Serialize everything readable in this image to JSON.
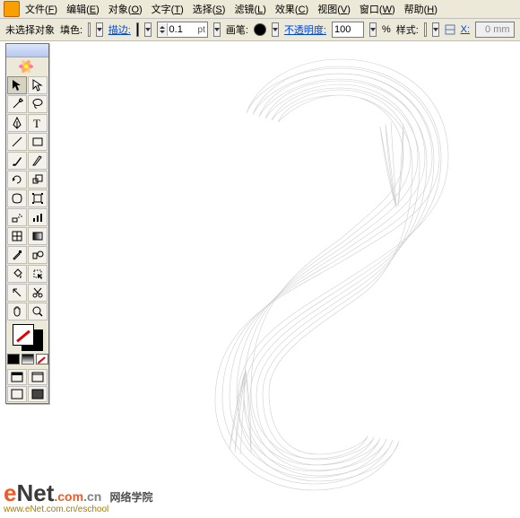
{
  "menu": {
    "items": [
      {
        "label": "文件",
        "accel": "F"
      },
      {
        "label": "编辑",
        "accel": "E"
      },
      {
        "label": "对象",
        "accel": "O"
      },
      {
        "label": "文字",
        "accel": "T"
      },
      {
        "label": "选择",
        "accel": "S"
      },
      {
        "label": "滤镜",
        "accel": "L"
      },
      {
        "label": "效果",
        "accel": "C"
      },
      {
        "label": "视图",
        "accel": "V"
      },
      {
        "label": "窗口",
        "accel": "W"
      },
      {
        "label": "帮助",
        "accel": "H"
      }
    ]
  },
  "optbar": {
    "selection_state": "未选择对象",
    "fill_label": "填色:",
    "stroke_label": "描边:",
    "stroke_weight": {
      "value": "0.1",
      "unit": "pt"
    },
    "brush_label": "画笔:",
    "opacity_label": "不透明度:",
    "opacity_value": "100",
    "opacity_unit": "%",
    "style_label": "样式:",
    "x_value": "0 mm"
  },
  "tools": [
    {
      "name": "selection",
      "selected": true
    },
    {
      "name": "direct-selection"
    },
    {
      "name": "magic-wand"
    },
    {
      "name": "lasso"
    },
    {
      "name": "pen"
    },
    {
      "name": "type"
    },
    {
      "name": "line-segment"
    },
    {
      "name": "rectangle"
    },
    {
      "name": "paintbrush"
    },
    {
      "name": "pencil"
    },
    {
      "name": "rotate"
    },
    {
      "name": "scale"
    },
    {
      "name": "warp"
    },
    {
      "name": "free-transform"
    },
    {
      "name": "symbol-sprayer"
    },
    {
      "name": "column-graph"
    },
    {
      "name": "mesh"
    },
    {
      "name": "gradient"
    },
    {
      "name": "eyedropper"
    },
    {
      "name": "blend"
    },
    {
      "name": "live-paint-bucket"
    },
    {
      "name": "live-paint-select"
    },
    {
      "name": "slice"
    },
    {
      "name": "scissors"
    },
    {
      "name": "hand"
    },
    {
      "name": "zoom"
    }
  ],
  "colors": {
    "fill_none": true,
    "stroke_color": "#000000"
  },
  "watermark": {
    "brand_e": "e",
    "brand_rest": "Net",
    "dot1": ".com",
    "dot2": ".cn",
    "school": "网络学院",
    "url": "www.eNet.com.cn/eschool"
  }
}
